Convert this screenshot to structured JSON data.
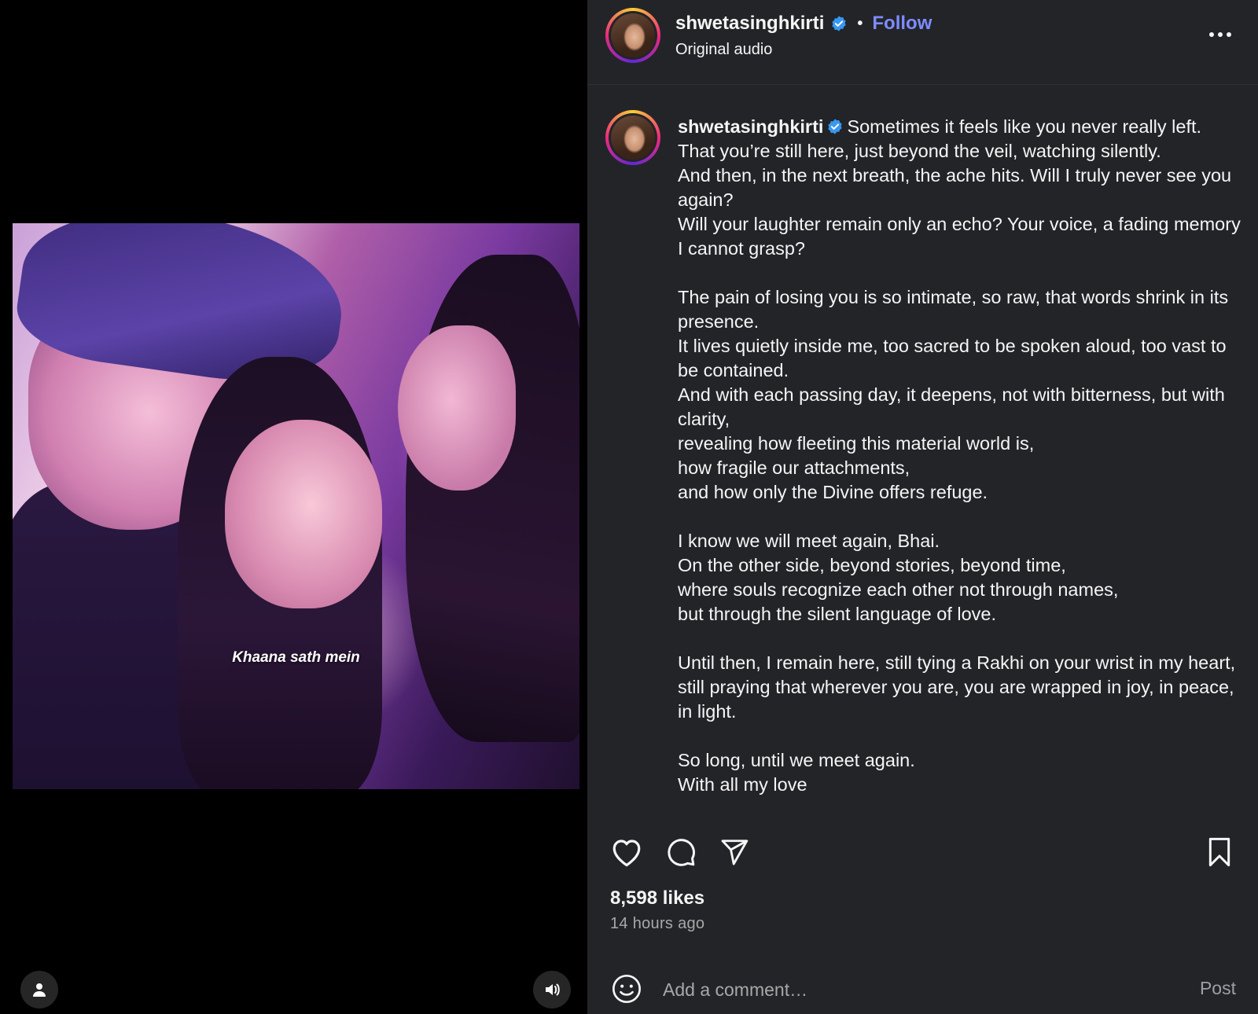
{
  "media": {
    "overlay_caption": "Khaana sath mein",
    "user_icon": "person-icon",
    "sound_icon": "speaker-icon"
  },
  "header": {
    "username": "shwetasinghkirti",
    "verified": true,
    "separator": "•",
    "follow_label": "Follow",
    "subtitle": "Original audio",
    "more_icon": "more-horizontal-icon"
  },
  "caption": {
    "username": "shwetasinghkirti",
    "text": "Sometimes it feels like you never really left.\nThat you’re still here, just beyond the veil, watching silently.\nAnd then, in the next breath, the ache hits. Will I truly never see you again?\nWill your laughter remain only an echo? Your voice, a fading memory I cannot grasp?\n\nThe pain of losing you is so intimate, so raw, that words shrink in its presence.\nIt lives quietly inside me, too sacred to be spoken aloud, too vast to be contained.\nAnd with each passing day, it deepens, not with bitterness, but with clarity,\nrevealing how fleeting this material world is,\nhow fragile our attachments,\nand how only the Divine offers refuge.\n\nI know we will meet again, Bhai.\nOn the other side, beyond stories, beyond time,\nwhere souls recognize each other not through names,\nbut through the silent language of love.\n\nUntil then, I remain here, still tying a Rakhi on your wrist in my heart,\nstill praying that wherever you are, you are wrapped in joy, in peace, in light.\n\nSo long, until we meet again.\nWith all my love"
  },
  "actions": {
    "like_icon": "heart-icon",
    "comment_icon": "comment-icon",
    "share_icon": "send-icon",
    "save_icon": "bookmark-icon",
    "likes": "8,598 likes",
    "time": "14 hours ago"
  },
  "comment_bar": {
    "emoji_icon": "emoji-icon",
    "placeholder": "Add a comment…",
    "post_label": "Post"
  },
  "colors": {
    "panel_bg": "#232428",
    "follow": "#7d8cff",
    "verified": "#3897f0",
    "secondary_text": "#a8a8a8"
  }
}
